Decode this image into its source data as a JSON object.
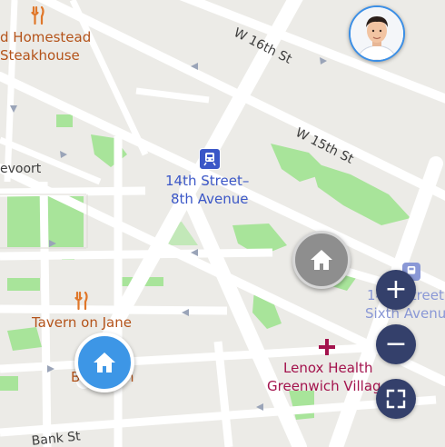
{
  "map": {
    "street_labels": [
      {
        "id": "w16",
        "text": "W 16th St"
      },
      {
        "id": "w15",
        "text": "W 15th St"
      },
      {
        "id": "gansevoort",
        "text": "evoort"
      },
      {
        "id": "bank",
        "text": "Bank St"
      }
    ],
    "poi_labels": {
      "homestead_line1": "d Homestead",
      "homestead_line2": "Steakhouse",
      "tavern": "Tavern on Jane",
      "station_line1": "14th Street–",
      "station_line2": "8th Avenue",
      "sixth_line1": "14th Street",
      "sixth_line2": "Sixth Avenu",
      "lenox_line1": "Lenox Health",
      "lenox_line2": "Greenwich Villag",
      "partial_b": "B",
      "partial_n": "n"
    },
    "icons": {
      "restaurant": "fork-knife-icon",
      "subway": "train-icon",
      "hospital": "cross-icon",
      "home": "home-icon"
    },
    "markers": {
      "home_active_color": "#3d96e6",
      "home_inactive_color": "#8e8e8e"
    },
    "controls": {
      "zoom_in": "+",
      "zoom_out": "−",
      "fullscreen": "fullscreen-icon"
    },
    "colors": {
      "land": "#ecebe7",
      "road": "#ffffff",
      "park": "#a8e49a",
      "control_bg": "#34406b",
      "poi_orange": "#b4531a",
      "transit_blue": "#3b57c7",
      "health": "#a3134d"
    }
  }
}
